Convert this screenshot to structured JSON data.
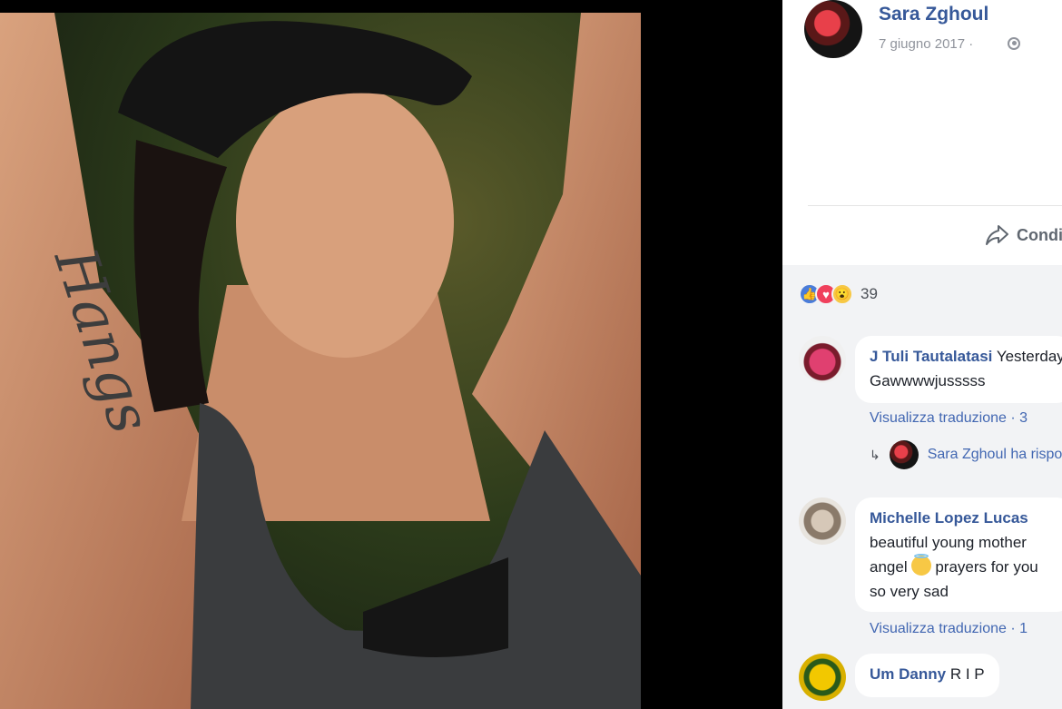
{
  "post": {
    "author": "Sara Zghoul",
    "date": "7 giugno 2017 ·",
    "share_label": "Condividi",
    "reaction_count": "39"
  },
  "reactions": [
    {
      "name": "like",
      "glyph": "👍"
    },
    {
      "name": "love",
      "glyph": "♥"
    },
    {
      "name": "wow",
      "glyph": "😮"
    }
  ],
  "comments": [
    {
      "author": "J Tuli Tautalatasi",
      "text": "Yesterday",
      "text2": "Gawwwwjusssss",
      "meta": "Visualizza traduzione · 3",
      "reply": "Sara Zghoul ha risposto"
    },
    {
      "author": "Michelle Lopez Lucas",
      "line1": "beautiful young mother",
      "line2_pre": "angel",
      "line2_post": "prayers for you",
      "line3": "so very sad",
      "meta": "Visualizza traduzione · 1"
    },
    {
      "author": "Um Danny",
      "text": "R I P"
    }
  ],
  "photo": {
    "tattoo_text": "Hangs"
  }
}
